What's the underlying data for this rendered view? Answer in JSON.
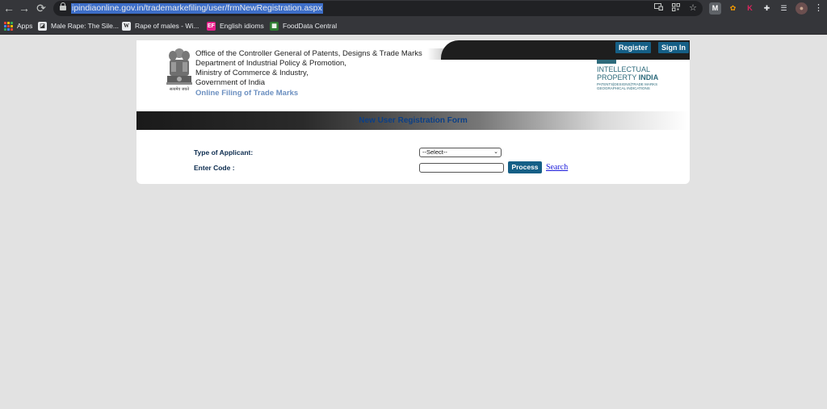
{
  "browser": {
    "url": "ipindiaonline.gov.in/trademarkefiling/user/frmNewRegistration.aspx",
    "nav": {
      "back": "←",
      "forward": "→",
      "reload": "⟳"
    },
    "omnibox_icons": [
      "screen-cast-icon",
      "qr-code-icon",
      "star-icon"
    ],
    "extensions": [
      {
        "name": "m-extension-icon",
        "glyph": "M",
        "bg": "#5f6368",
        "fg": "#ffffff"
      },
      {
        "name": "honey-extension-icon",
        "glyph": "✿",
        "bg": "#35363a",
        "fg": "#f29900"
      },
      {
        "name": "k-extension-icon",
        "glyph": "K",
        "bg": "#35363a",
        "fg": "#e0245e"
      },
      {
        "name": "puzzle-extensions-icon",
        "glyph": "✚",
        "bg": "#35363a",
        "fg": "#e8eaed"
      },
      {
        "name": "reading-list-icon",
        "glyph": "☰",
        "bg": "#35363a",
        "fg": "#e8eaed"
      },
      {
        "name": "profile-avatar-icon",
        "glyph": "●",
        "bg": "#6b4f4f",
        "fg": "#c9a892"
      },
      {
        "name": "menu-kebab-icon",
        "glyph": "⋮",
        "bg": "#35363a",
        "fg": "#e8eaed"
      }
    ],
    "bookmarks": [
      {
        "label": "Apps"
      },
      {
        "label": "Male Rape: The Sile..."
      },
      {
        "label": "Rape of males - Wi..."
      },
      {
        "label": "English idioms"
      },
      {
        "label": "FoodData Central"
      }
    ]
  },
  "header": {
    "register_label": "Register",
    "signin_label": "Sign In",
    "org_lines": [
      "Office of the Controller General of Patents, Designs & Trade Marks",
      "Department of Industrial Policy & Promotion,",
      "Ministry of Commerce & Industry,",
      "Government of India"
    ],
    "tagline": "Online Filing of Trade Marks",
    "emblem_motto": "सत्यमेव जयते",
    "ip_logo": {
      "line1": "INTELLECTUAL",
      "line2a": "PROPERTY ",
      "line2b": "INDIA",
      "line3": "PATENTS|DESIGNS|TRADE MARKS",
      "line4": "GEOGRAPHICAL INDICATIONS"
    }
  },
  "form": {
    "title": "New User Registration Form",
    "applicant_label": "Type of Applicant:",
    "applicant_selected": "--Select--",
    "code_label": "Enter Code :",
    "code_value": "",
    "process_label": "Process",
    "search_label": "Search"
  },
  "colors": {
    "button_bg": "#155f86",
    "title_text": "#0b3f86",
    "tagline": "#6b8fc0",
    "ip_brand": "#2d6a7b",
    "url_highlight": "#3d6ec8"
  }
}
